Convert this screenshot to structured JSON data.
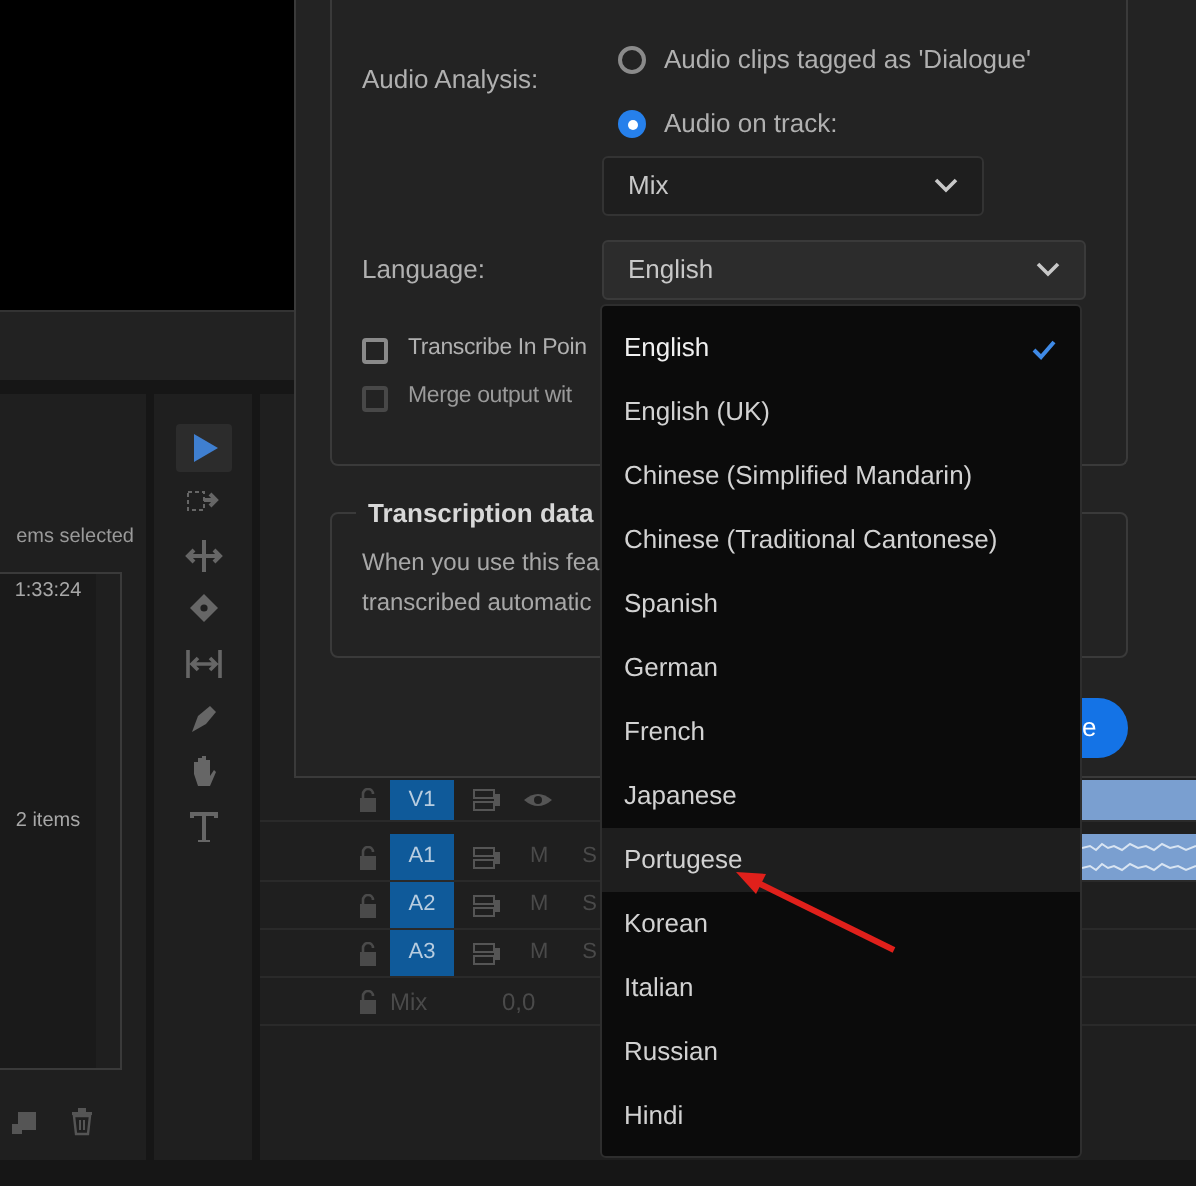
{
  "project_panel": {
    "selection_text": "ems selected",
    "duration": "1:33:24",
    "item_count": "2 items"
  },
  "tools": [
    {
      "kind": "select",
      "selected": true
    },
    {
      "kind": "track-select",
      "selected": false
    },
    {
      "kind": "ripple",
      "selected": false
    },
    {
      "kind": "razor",
      "selected": false
    },
    {
      "kind": "slip",
      "selected": false
    },
    {
      "kind": "pen",
      "selected": false
    },
    {
      "kind": "hand",
      "selected": false
    },
    {
      "kind": "type",
      "selected": false
    }
  ],
  "tracks": [
    {
      "kind": "video",
      "name": "V1",
      "has_clip": true
    },
    {
      "kind": "audio",
      "name": "A1",
      "mute": "M",
      "solo": "S",
      "has_clip": true
    },
    {
      "kind": "audio",
      "name": "A2",
      "mute": "M",
      "solo": "S",
      "has_clip": false
    },
    {
      "kind": "audio",
      "name": "A3",
      "mute": "M",
      "solo": "S",
      "has_clip": false
    },
    {
      "kind": "mix",
      "name": "Mix",
      "value": "0,0",
      "has_clip": false
    }
  ],
  "dialog": {
    "audio_analysis_label": "Audio Analysis:",
    "audio_options": [
      {
        "label": "Audio clips tagged as 'Dialogue'",
        "selected": false
      },
      {
        "label": "Audio on track:",
        "selected": true
      }
    ],
    "track_select": {
      "value": "Mix"
    },
    "language_label": "Language:",
    "language_select": {
      "value": "English"
    },
    "checkboxes": [
      {
        "label": "Transcribe In Poin",
        "checked": false,
        "disabled": false
      },
      {
        "label": "Merge output wit",
        "checked": false,
        "disabled": true
      }
    ],
    "transcription_data": {
      "title": "Transcription data",
      "lines": [
        "When you use this fea",
        "transcribed automatic"
      ]
    },
    "primary_button": "e"
  },
  "language_menu": [
    {
      "label": "English",
      "selected": true,
      "highlighted": false
    },
    {
      "label": "English (UK)",
      "selected": false,
      "highlighted": false
    },
    {
      "label": "Chinese (Simplified Mandarin)",
      "selected": false,
      "highlighted": false
    },
    {
      "label": "Chinese (Traditional Cantonese)",
      "selected": false,
      "highlighted": false
    },
    {
      "label": "Spanish",
      "selected": false,
      "highlighted": false
    },
    {
      "label": "German",
      "selected": false,
      "highlighted": false
    },
    {
      "label": "French",
      "selected": false,
      "highlighted": false
    },
    {
      "label": "Japanese",
      "selected": false,
      "highlighted": false
    },
    {
      "label": "Portugese",
      "selected": false,
      "highlighted": true
    },
    {
      "label": "Korean",
      "selected": false,
      "highlighted": false
    },
    {
      "label": "Italian",
      "selected": false,
      "highlighted": false
    },
    {
      "label": "Russian",
      "selected": false,
      "highlighted": false
    },
    {
      "label": "Hindi",
      "selected": false,
      "highlighted": false
    }
  ]
}
